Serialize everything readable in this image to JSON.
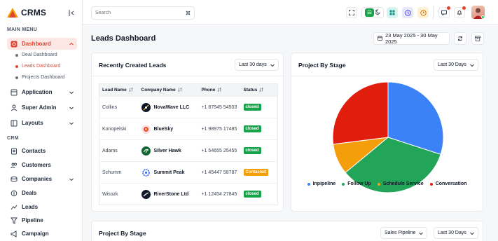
{
  "app": {
    "name": "CRMS",
    "brand_color": "#e0442f"
  },
  "sidebar": {
    "main_menu_title": "MAIN MENU",
    "crm_title": "CRM",
    "dashboard": {
      "label": "Dashboard",
      "icon": "dashboard-icon"
    },
    "dashboard_sub": [
      {
        "label": "Deal Dashboard"
      },
      {
        "label": "Leads Dashboard"
      },
      {
        "label": "Projects Dashboard"
      }
    ],
    "groups": [
      {
        "label": "Application",
        "icon": "application-icon"
      },
      {
        "label": "Super Admin",
        "icon": "user-icon"
      },
      {
        "label": "Layouts",
        "icon": "layout-icon"
      }
    ],
    "crm_items": [
      {
        "label": "Contacts",
        "icon": "contacts-icon"
      },
      {
        "label": "Customers",
        "icon": "customers-icon"
      },
      {
        "label": "Companies",
        "icon": "companies-icon"
      },
      {
        "label": "Deals",
        "icon": "deals-icon"
      },
      {
        "label": "Leads",
        "icon": "leads-icon"
      },
      {
        "label": "Pipeline",
        "icon": "pipeline-icon"
      },
      {
        "label": "Campaign",
        "icon": "campaign-icon"
      }
    ]
  },
  "topbar": {
    "search_placeholder": "Search"
  },
  "page": {
    "title": "Leads Dashboard",
    "date_range": "23 May 2025 - 30 May 2025"
  },
  "recent_leads": {
    "title": "Recently Created Leads",
    "filter": "Last 30 days",
    "columns": [
      "Lead Name",
      "Company Name",
      "Phone",
      "Status"
    ],
    "rows": [
      {
        "lead": "Collins",
        "company": "NovaWave LLC",
        "phone": "+1 87545 54503",
        "status": "closed",
        "logo_color": "#0f172a"
      },
      {
        "lead": "Konopelski",
        "company": "BlueSky",
        "phone": "+1 98975 17485",
        "status": "closed",
        "logo_color": "#ef4444"
      },
      {
        "lead": "Adams",
        "company": "Silver Hawk",
        "phone": "+1 54655 25455",
        "status": "closed",
        "logo_color": "#14532d"
      },
      {
        "lead": "Schumm",
        "company": "Summit  Peak",
        "phone": "+1 45447 58787",
        "status": "Contacted",
        "logo_color": "#2563eb"
      },
      {
        "lead": "Wisozk",
        "company": "RiverStone Ltd",
        "phone": "+1 12454 27845",
        "status": "closed",
        "logo_color": "#111827"
      }
    ]
  },
  "project_stage_card": {
    "title": "Project By Stage",
    "filter": "Last 30 Days"
  },
  "project_stage_card2": {
    "title": "Project By Stage",
    "pipeline_filter": "Sales Pipeline",
    "filter": "Last 30 Days"
  },
  "chart_data": {
    "type": "pie",
    "categories": [
      "Inpipeline",
      "Follow Up",
      "Schedule Service",
      "Conversation"
    ],
    "values": [
      30,
      34,
      9,
      27
    ],
    "colors": [
      "#3b82f6",
      "#22a559",
      "#f59e0b",
      "#e11d0e"
    ],
    "legend_position": "bottom"
  }
}
